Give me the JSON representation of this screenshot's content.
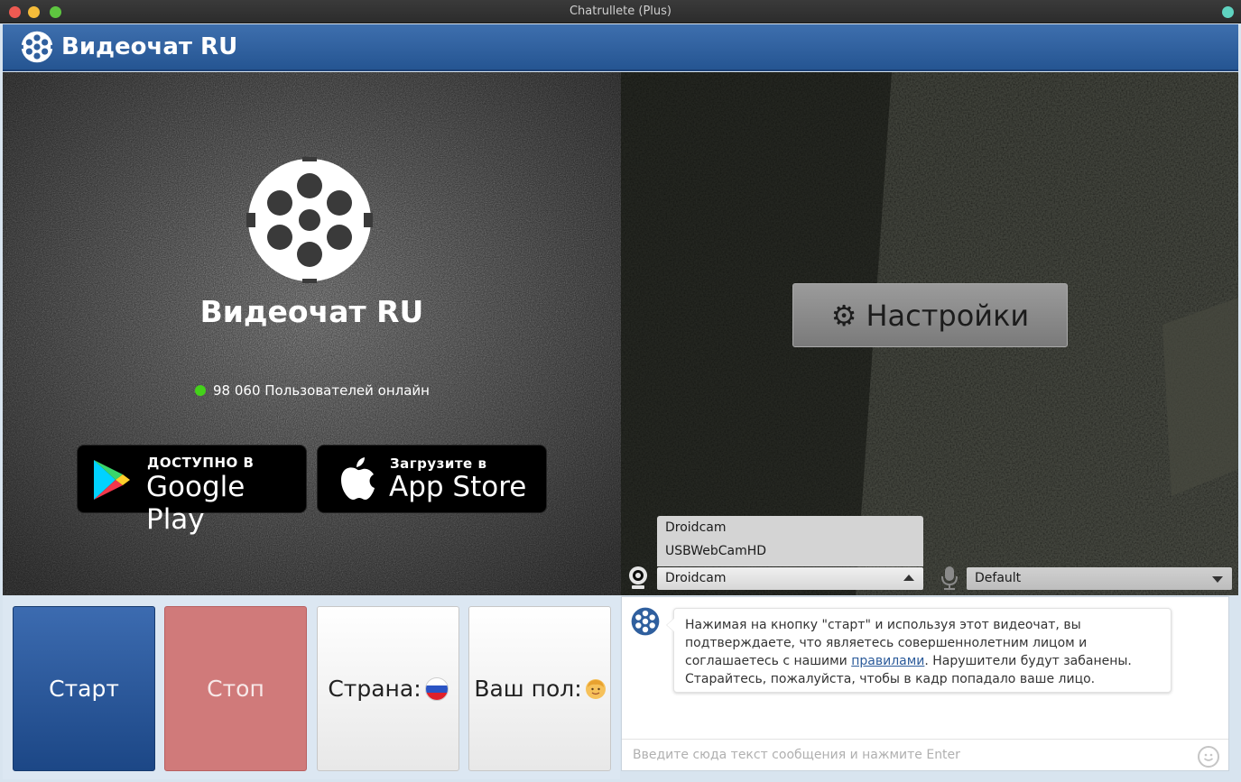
{
  "window": {
    "title": "Chatrullete (Plus)"
  },
  "header": {
    "brand": "Видеочат RU"
  },
  "left": {
    "brand": "Видеочат RU",
    "online_count": "98 060",
    "online_label": "Пользователей онлайн",
    "google_play": {
      "small": "ДОСТУПНО В",
      "big": "Google Play"
    },
    "app_store": {
      "small": "Загрузите в",
      "big": "App Store"
    }
  },
  "right": {
    "settings_label": "Настройки",
    "camera_options": [
      "Droidcam",
      "USBWebCamHD"
    ],
    "camera_selected": "Droidcam",
    "mic_selected": "Default"
  },
  "buttons": {
    "start": "Старт",
    "stop": "Стоп",
    "country": "Страна:",
    "gender": "Ваш пол:"
  },
  "chat": {
    "notice_part1": "Нажимая на кнопку \"старт\" и используя этот видеочат, вы подтверждаете, что являетесь совершеннолетним лицом и соглашаетесь с нашими ",
    "notice_link": "правилами",
    "notice_part2": ". Нарушители будут забанены. Старайтесь, пожалуйста, чтобы в кадр попадало ваше лицо.",
    "input_placeholder": "Введите сюда текст сообщения и нажмите Enter"
  },
  "colors": {
    "header": "#2f5f9e",
    "start": "#2a5799",
    "stop": "#d07a7a",
    "online_dot": "#44d21a"
  }
}
